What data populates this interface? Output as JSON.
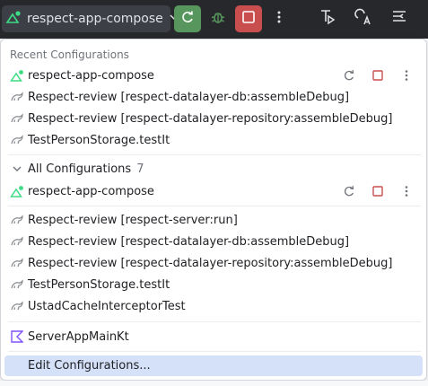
{
  "toolbar": {
    "run_config": "respect-app-compose",
    "icons": [
      "android-run-config-icon",
      "chevron-down-icon",
      "rerun-icon",
      "debug-icon",
      "stop-icon",
      "more-vertical-icon",
      "run-with-coverage-icon",
      "translate-icon",
      "structure-icon"
    ]
  },
  "recent": {
    "header": "Recent Configurations",
    "items": [
      {
        "label": "respect-app-compose",
        "icon": "android-run-config-icon"
      },
      {
        "label": "Respect-review [respect-datalayer-db:assembleDebug]",
        "icon": "gradle-icon"
      },
      {
        "label": "Respect-review [respect-datalayer-repository:assembleDebug]",
        "icon": "gradle-icon"
      },
      {
        "label": "TestPersonStorage.testIt",
        "icon": "gradle-icon"
      }
    ]
  },
  "all": {
    "header": "All Configurations",
    "count": "7",
    "pinned": {
      "label": "respect-app-compose",
      "icon": "android-run-config-icon"
    },
    "items": [
      {
        "label": "Respect-review [respect-server:run]",
        "icon": "gradle-icon"
      },
      {
        "label": "Respect-review [respect-datalayer-db:assembleDebug]",
        "icon": "gradle-icon"
      },
      {
        "label": "Respect-review [respect-datalayer-repository:assembleDebug]",
        "icon": "gradle-icon"
      },
      {
        "label": "TestPersonStorage.testIt",
        "icon": "gradle-icon"
      },
      {
        "label": "UstadCacheInterceptorTest",
        "icon": "gradle-icon"
      }
    ],
    "kotlin_item": {
      "label": "ServerAppMainKt",
      "icon": "kotlin-icon"
    }
  },
  "edit_configurations": "Edit Configurations...",
  "colors": {
    "toolbar_bg": "#27282c",
    "rerun_green": "#57965c",
    "stop_red": "#c94f4f",
    "selection": "#d5e1f8",
    "android_green": "#3ddc84"
  }
}
